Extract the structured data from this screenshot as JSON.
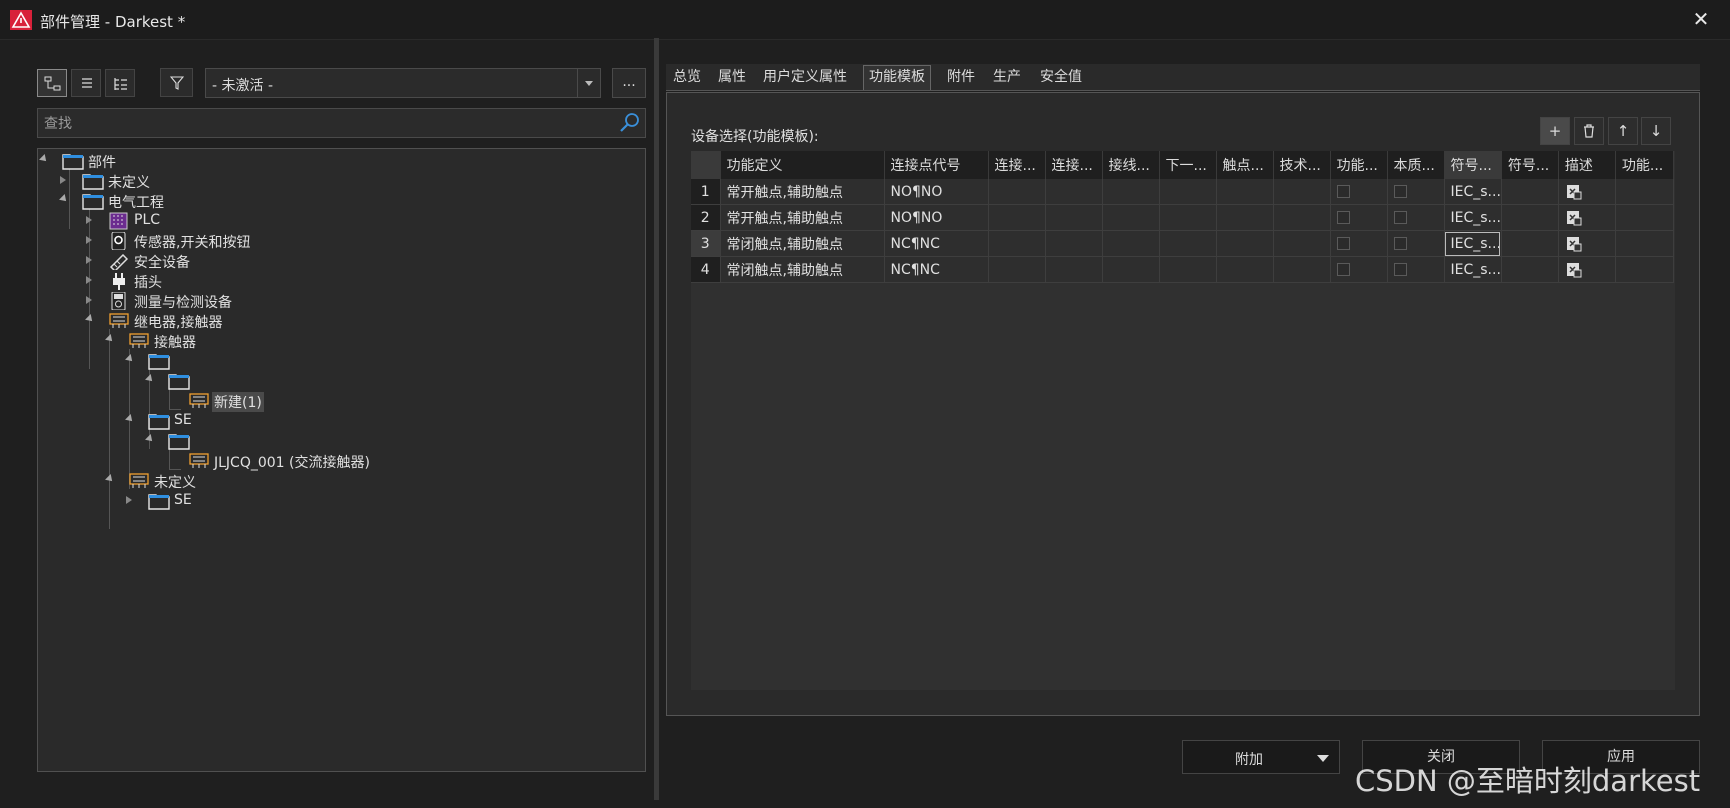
{
  "window": {
    "title": "部件管理 - Darkest *",
    "close_glyph": "✕",
    "app_icon": "eplan-warning-icon",
    "accent_color": "#d8213a"
  },
  "left": {
    "view_buttons": [
      "tree-view-icon",
      "list-view-icon",
      "hierarchy-view-icon"
    ],
    "filter_icon": "filter-icon",
    "filter_value": "- 未激活 -",
    "more_label": "...",
    "search_placeholder": "查找",
    "tree": {
      "root": "部件",
      "undefined_top": "未定义",
      "electrical": "电气工程",
      "plc": "PLC",
      "sensors": "传感器,开关和按钮",
      "safety": "安全设备",
      "plug": "插头",
      "measure": "测量与检测设备",
      "relay": "继电器,接触器",
      "contactor": "接触器",
      "new_item": "新建(1)",
      "se_1": "SE",
      "jlj_item": "JLJCQ_001 (交流接触器)",
      "undefined_sub": "未定义",
      "se_2": "SE"
    }
  },
  "right": {
    "tabs": [
      "总览",
      "属性",
      "用户定义属性",
      "功能模板",
      "附件",
      "生产",
      "安全值"
    ],
    "active_tab": "功能模板",
    "grid_caption": "设备选择(功能模板):",
    "grid_buttons": {
      "add": "+",
      "up": "↑",
      "down": "↓"
    },
    "columns": [
      "功能定义",
      "连接点代号",
      "连接...",
      "连接...",
      "接线...",
      "下一...",
      "触点...",
      "技术...",
      "功能...",
      "本质...",
      "符号...",
      "符号...",
      "描述",
      "功能..."
    ],
    "rows": [
      {
        "num": "1",
        "func": "常开触点,辅助触点",
        "conn": "NO¶NO",
        "sym": "IEC_s..."
      },
      {
        "num": "2",
        "func": "常开触点,辅助触点",
        "conn": "NO¶NO",
        "sym": "IEC_s..."
      },
      {
        "num": "3",
        "func": "常闭触点,辅助触点",
        "conn": "NC¶NC",
        "sym": "IEC_s..."
      },
      {
        "num": "4",
        "func": "常闭触点,辅助触点",
        "conn": "NC¶NC",
        "sym": "IEC_s..."
      }
    ]
  },
  "buttons": {
    "attach": "附加",
    "close": "关闭",
    "apply": "应用"
  },
  "watermark": "CSDN @至暗时刻darkest"
}
